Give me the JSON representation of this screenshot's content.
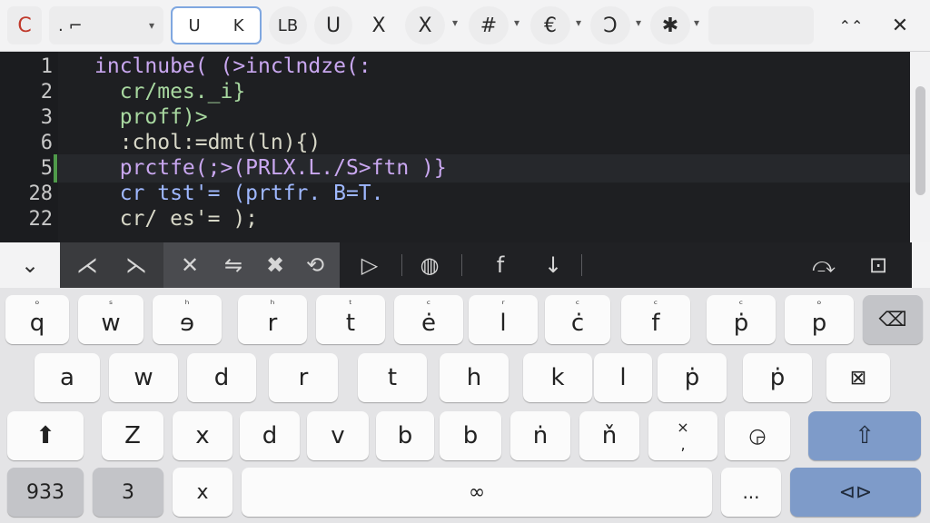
{
  "toolbar": {
    "btn_first": "C",
    "dropdown_value": ". ⌐",
    "selected_a": "U",
    "selected_b": "K",
    "b1": "LB",
    "b2": "U",
    "b3": "X",
    "b4": "X",
    "b5": "#",
    "b6": "€",
    "b7": "Ͻ",
    "b8": "✱",
    "collapse": "⌃⌃",
    "close": "✕",
    "caret": "▾"
  },
  "editor": {
    "lines": [
      {
        "num": "1",
        "code": "inclnube( (>inclndze(:"
      },
      {
        "num": "2",
        "code": "  cr/mes._i}"
      },
      {
        "num": "3",
        "code": "  proff)>"
      },
      {
        "num": "6",
        "code": "  :chol:=dmt(ln){)"
      },
      {
        "num": "5",
        "code": "  prctfe(;>(PRLX.L./S>ftn )}"
      },
      {
        "num": "28",
        "code": "  cr tst'= (prtfr. B=T."
      },
      {
        "num": "22",
        "code": "  cr/ es'= );"
      }
    ],
    "colors": {
      "keyword": "#c792ea",
      "text": "#d8d8c8",
      "green": "#a8d8a0",
      "blue": "#82aaff",
      "purple": "#c792ea"
    }
  },
  "accessory": {
    "collapse": "⌄",
    "a1": "⋌",
    "a2": "⋋",
    "cut": "✕",
    "swap": "⇋",
    "x2": "✖",
    "rot": "⟲",
    "play": "▷",
    "globe": "◍",
    "f": "f",
    "down": "↓",
    "undo": "⤼",
    "box": "⊡"
  },
  "keyboard": {
    "row1": [
      {
        "hint": "ᵒ",
        "key": "q"
      },
      {
        "hint": "ˢ",
        "key": "w"
      },
      {
        "hint": "ʰ",
        "key": "ɘ"
      },
      {
        "hint": "ʰ",
        "key": "r"
      },
      {
        "hint": "ᵗ",
        "key": "t"
      },
      {
        "hint": "ᶜ",
        "key": "ė"
      },
      {
        "hint": "ʳ",
        "key": "l"
      },
      {
        "hint": "ᶜ",
        "key": "ċ"
      },
      {
        "hint": "ᶜ",
        "key": "f"
      },
      {
        "hint": "ᶜ",
        "key": "ṗ"
      },
      {
        "hint": "ᵒ",
        "key": "p"
      }
    ],
    "row1_back": "⌫",
    "row2": [
      "a",
      "w",
      "d",
      "r",
      "t",
      "h",
      "k",
      "l",
      "ṗ",
      "ṗ"
    ],
    "row2_del": "⊠",
    "row3_shift": "⬆",
    "row3": [
      "Z",
      "x",
      "d",
      "v",
      "b",
      "b",
      "ṅ",
      "ň"
    ],
    "row3_punct_top": "×",
    "row3_punct_bottom": ",",
    "row3_emoji": "◶",
    "row3_shift_right": "⇧",
    "row4_num": "933",
    "row4_three": "3",
    "row4_x": "x",
    "row4_space": "∞",
    "row4_dots": "...",
    "row4_return": "⊲⊳"
  }
}
